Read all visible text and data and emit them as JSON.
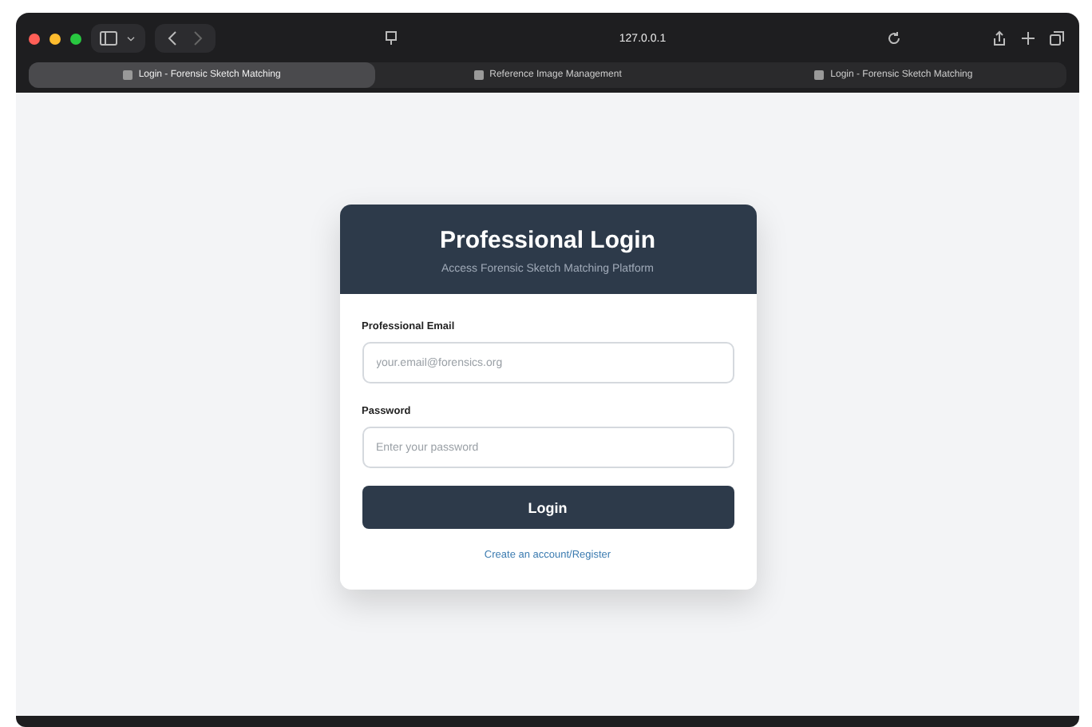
{
  "browser": {
    "address": "127.0.0.1",
    "tabs": [
      {
        "label": "Login - Forensic Sketch Matching",
        "selected": true
      },
      {
        "label": "Reference Image Management",
        "selected": false
      },
      {
        "label": "Login - Forensic Sketch Matching",
        "selected": false
      }
    ]
  },
  "login": {
    "title": "Professional Login",
    "subtitle": "Access Forensic Sketch Matching Platform",
    "fields": [
      {
        "label": "Professional Email",
        "placeholder": "your.email@forensics.org"
      },
      {
        "label": "Password",
        "placeholder": "Enter your password"
      }
    ],
    "button": "Login",
    "link": "Create an account/Register"
  }
}
